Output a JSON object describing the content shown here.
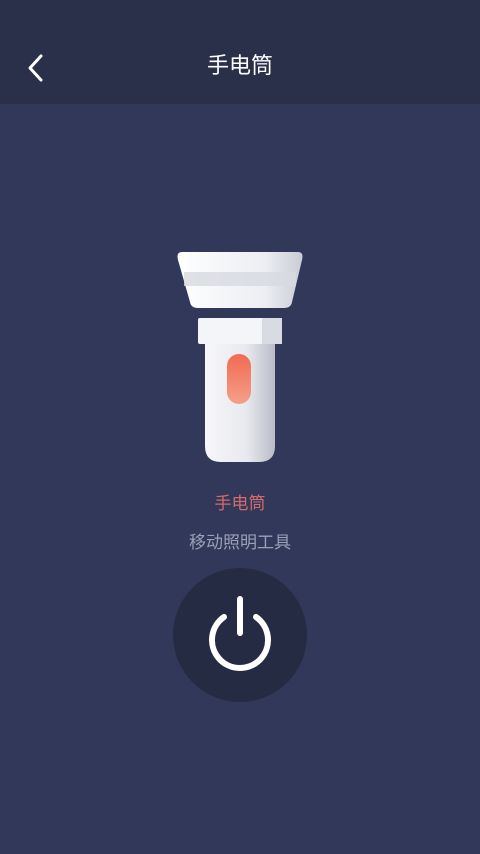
{
  "header": {
    "title": "手电筒",
    "back_icon": "chevron-left-icon"
  },
  "main": {
    "illustration": "flashlight-icon",
    "name": "手电筒",
    "description": "移动照明工具",
    "power_icon": "power-icon"
  },
  "colors": {
    "background": "#31385a",
    "header": "#2a2f4a",
    "accent": "#d46a6a",
    "power_button": "#262b44",
    "indicator": "#f0705a"
  }
}
